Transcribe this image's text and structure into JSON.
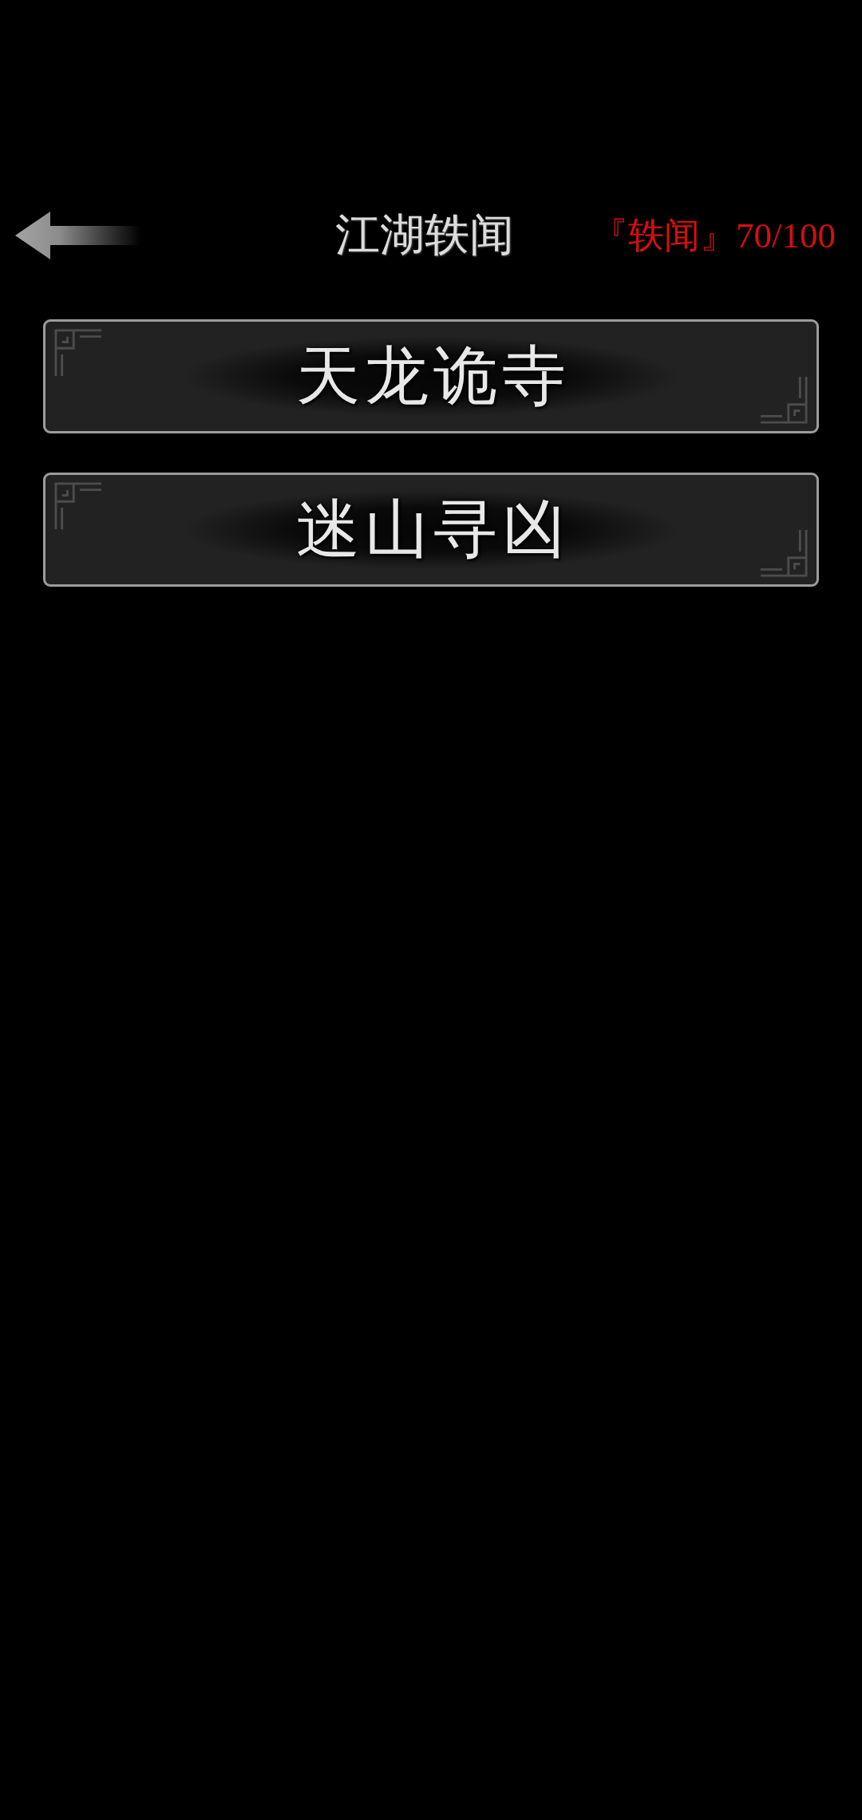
{
  "header": {
    "title": "江湖轶闻",
    "progress": "『轶闻』70/100"
  },
  "chapters": [
    {
      "title": "天龙诡寺"
    },
    {
      "title": "迷山寻凶"
    }
  ]
}
